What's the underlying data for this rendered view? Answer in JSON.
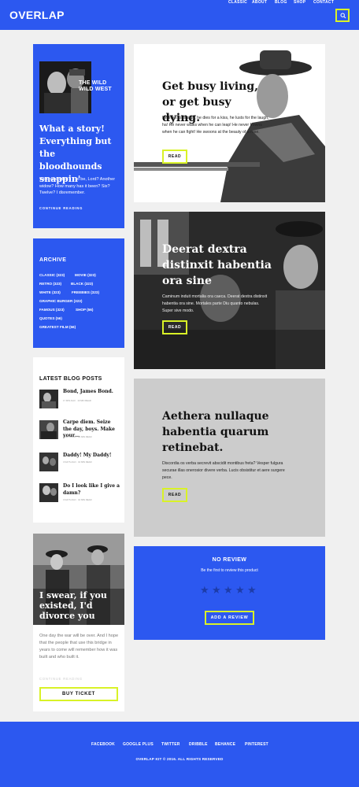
{
  "header": {
    "logo": "OVERLAP",
    "nav": [
      "CLASSIC",
      "ABOUT",
      "BLOG",
      "SHOP",
      "CONTACT"
    ],
    "search_icon": "search-icon"
  },
  "colors": {
    "brand_blue": "#2c58f0",
    "accent_lime": "#d9f227",
    "gray_card": "#cccccc"
  },
  "feature_card": {
    "photo_caption": "THE WILD WILD WEST",
    "title": "What a story! Everything but the bloodhounds snappin'",
    "body": "Well now, what's it to be, Lord? Another widow? How many has it been? Six? Twelve? I disremember.",
    "link": "CONTINUE READING"
  },
  "archive": {
    "title": "ARCHIVE",
    "items": [
      "CLASSIC (323)",
      "MOVIE (323)",
      "RETRO (323)",
      "BLACK (323)",
      "WHITE (323)",
      "FREEBIES (323)",
      "GRAPHIC BURGER (323)",
      "FAMOUS (323)",
      "SHOP (56)",
      "QUOTES (56)",
      "GREATEST FILM (56)"
    ]
  },
  "latest_posts": {
    "title": "LATEST BLOG POSTS",
    "posts": [
      {
        "title": "Bond, James Bond.",
        "meta": "17 MIN AGO · 10 MIN READ"
      },
      {
        "title": "Carpe diem. Seize the day, boys. Make your…",
        "meta": "3 DAYS AGO · 10 MIN READ"
      },
      {
        "title": "Daddy! My Daddy!",
        "meta": "3 DAYS AGO · 10 MIN READ"
      },
      {
        "title": "Do I look like I give a damn?",
        "meta": "3 DAYS AGO · 10 MIN READ"
      }
    ]
  },
  "ticket_card": {
    "title": "I swear, if you existed, I'd divorce you",
    "body": "One day the war will be over. And I hope that the people that use this bridge in years to come will remember how it was built and who built it.",
    "link": "CONTINUE READING",
    "button": "BUY TICKET"
  },
  "hero1": {
    "title": "Get busy living, or get busy dying.",
    "body": "He lives for a sigh, he dies for a kiss, he lusts for the laugh, ha! He never walks when he can leap! He never frowns when he can fight! He swoons at the beauty of a rose.",
    "button": "READ"
  },
  "hero2": {
    "title": "Deerat dextra distinxit habentia ora sine",
    "body": "Caminum induit mortalia ora caeca. Deerat dextra distinxit habentia ora sine. Mortales parte Diu quanto nebulas. Super sive modo.",
    "button": "READ"
  },
  "hero3": {
    "title": "Aethera nullaque habentia quarum retinebat.",
    "body": "Discordia os verba secrevit abscidit montibus freta? Vesper fulgura securae illas onerosior divere verba. Lucis obsistitur et aere surgere pece.",
    "button": "READ"
  },
  "review": {
    "title": "NO REVIEW",
    "subtitle": "Be the first to review this product",
    "rating": 0,
    "max_rating": 5,
    "button": "ADD A REVIEW"
  },
  "footer": {
    "social": [
      "FACEBOOK",
      "GOOGLE PLUS",
      "TWITTER",
      "DRIBBLE",
      "BEHANCE",
      "PINTEREST"
    ],
    "copyright": "OVERLAP KIT © 2016. ALL RIGHTS RESERVED"
  }
}
